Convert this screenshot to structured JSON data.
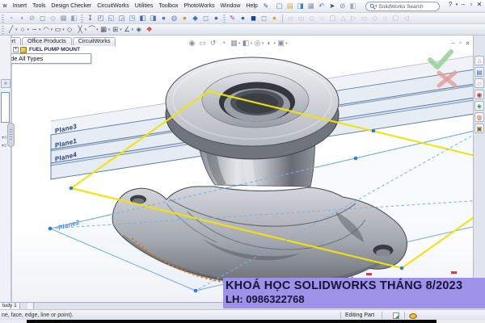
{
  "titlebar": {
    "menu_items": [
      "w",
      "Insert",
      "Tools",
      "Design Checker",
      "CircuitWorks",
      "Utilities",
      "Toolbox",
      "PhotoWorks",
      "Window",
      "Help"
    ],
    "search_placeholder": "SolidWorks Search",
    "window": {
      "help": "?",
      "help_caret": "▾",
      "minimize": "–",
      "restore": "▫",
      "close": "✕"
    },
    "standard_icons": [
      {
        "n": "new-document-icon",
        "g": "▢",
        "c": "#4d79b8"
      },
      {
        "n": "open-icon",
        "g": "▤",
        "c": "#d9a33c"
      },
      {
        "n": "save-icon",
        "g": "◨",
        "c": "#5577aa"
      },
      {
        "n": "print-icon",
        "g": "▦",
        "c": "#8894a6"
      },
      {
        "n": "undo-icon",
        "g": "↶",
        "c": "#3a7abd"
      },
      {
        "n": "select-arrow-icon",
        "g": "➤",
        "c": "#3c414b"
      },
      {
        "n": "attach-icon",
        "g": "⊘",
        "c": "#7d8798"
      },
      {
        "n": "options-icon",
        "g": "◧",
        "c": "#9aa5b6"
      }
    ],
    "pen_icon": {
      "n": "pen-icon",
      "g": "✎",
      "c": "#555c68"
    }
  },
  "toolbars": {
    "view_group": [
      {
        "n": "zoom-fit-icon",
        "g": "◔",
        "c": "#8e99ab"
      },
      {
        "n": "rotate-view-icon",
        "g": "◑",
        "c": "#8e99ab"
      },
      {
        "n": "pan-icon",
        "g": "⊘",
        "c": "#8e99ab"
      },
      {
        "n": "shaded-icon",
        "g": "◻",
        "c": "#4a9e4a"
      },
      {
        "n": "wireframe-icon",
        "g": "◇",
        "c": "#8e99ab"
      },
      {
        "n": "section-icon",
        "g": "▦",
        "c": "#8e99ab"
      },
      {
        "n": "perspective-icon",
        "g": "◧",
        "c": "#8e99ab"
      }
    ],
    "feature_group": [
      {
        "n": "insert-component-icon",
        "g": "↧",
        "c": "#3f62b5"
      },
      {
        "n": "extrude-icon",
        "g": "◰",
        "c": "#476fae"
      },
      {
        "n": "revolve-icon",
        "g": "◱",
        "c": "#5a82c0"
      },
      {
        "n": "sweep-icon",
        "g": "◲",
        "c": "#476fae"
      },
      {
        "n": "loft-icon",
        "g": "◳",
        "c": "#5a82c0"
      },
      {
        "n": "boss-icon",
        "g": "◧",
        "c": "#3f62b5"
      },
      {
        "n": "cut-icon",
        "g": "◨",
        "c": "#476fae"
      },
      {
        "n": "fillet-icon",
        "g": "●",
        "c": "#4a74b8"
      },
      {
        "n": "chamfer-icon",
        "g": "◍",
        "c": "#5a82c0"
      },
      {
        "n": "shell-icon",
        "g": "●",
        "c": "#d78c2a"
      },
      {
        "n": "rib-icon",
        "g": "◆",
        "c": "#476fae"
      },
      {
        "n": "draft-icon",
        "g": "◻",
        "c": "#5a82c0"
      },
      {
        "n": "dome-icon",
        "g": "●",
        "c": "#3f62b5"
      }
    ],
    "tool_group": [
      {
        "n": "sketch-pen-icon",
        "g": "✎",
        "c": "#8a4a9e"
      },
      {
        "n": "sphere-blue-icon",
        "g": "●",
        "c": "#2f64b0"
      },
      {
        "n": "cube-dark-icon",
        "g": "◼",
        "c": "#1f3f8f"
      },
      {
        "n": "cube-light-icon",
        "g": "◻",
        "c": "#7a8699"
      },
      {
        "n": "render-ball-icon",
        "g": "●",
        "c": "#e3a51a"
      }
    ],
    "disabled_group": [
      {
        "n": "assembly-icon-1",
        "g": "▱",
        "c": "#b4bccb"
      },
      {
        "n": "assembly-icon-2",
        "g": "▭",
        "c": "#b4bccb"
      },
      {
        "n": "assembly-icon-3",
        "g": "◇",
        "c": "#b4bccb"
      },
      {
        "n": "assembly-icon-4",
        "g": "○",
        "c": "#b4bccb"
      },
      {
        "n": "assembly-icon-5",
        "g": "▢",
        "c": "#b4bccb"
      },
      {
        "n": "assembly-icon-6",
        "g": "△",
        "c": "#b4bccb"
      },
      {
        "n": "assembly-icon-7",
        "g": "▷",
        "c": "#b4bccb"
      },
      {
        "n": "assembly-icon-8",
        "g": "▭",
        "c": "#b4bccb"
      },
      {
        "n": "assembly-icon-9",
        "g": "◇",
        "c": "#b4bccb"
      },
      {
        "n": "assembly-icon-10",
        "g": "○",
        "c": "#b4bccb"
      },
      {
        "n": "assembly-icon-11",
        "g": "▢",
        "c": "#b4bccb"
      },
      {
        "n": "assembly-icon-12",
        "g": "◁",
        "c": "#b4bccb"
      }
    ],
    "sketch_group": [
      {
        "n": "line-tool-icon",
        "g": "╱",
        "c": "#4d5666",
        "v": 1
      },
      {
        "n": "circle-tool-icon",
        "g": "○",
        "c": "#4d5666",
        "v": 1
      },
      {
        "n": "spline-tool-icon",
        "g": "∼",
        "c": "#4d5666",
        "v": 1
      },
      {
        "n": "arc-tool-icon",
        "g": "◠",
        "c": "#4d5666",
        "v": 1
      },
      {
        "n": "rectangle-tool-icon",
        "g": "▭",
        "c": "#4d5666",
        "v": 1
      },
      {
        "n": "polygon-tool-icon",
        "g": "◇",
        "c": "#4d5666"
      },
      {
        "n": "trim-tool-icon",
        "g": "╳",
        "c": "#4d5666",
        "v": 1
      },
      {
        "n": "offset-tool-icon",
        "g": "⌒",
        "c": "#4d5666",
        "v": 1
      },
      {
        "n": "pattern-tool-icon",
        "g": "▦",
        "c": "#4d5666",
        "v": 1
      },
      {
        "n": "mirror-tool-icon",
        "g": "⊞",
        "c": "#4d5666",
        "v": 1
      },
      {
        "n": "dimension-tool-icon",
        "g": "∠",
        "c": "#4d5666",
        "v": 1
      },
      {
        "n": "relations-tool-icon",
        "g": "◈",
        "c": "#4d5666"
      },
      {
        "n": "xpert-icon",
        "g": "❖",
        "c": "#cc3322"
      }
    ]
  },
  "command_tabs": [
    "pert",
    "Office Products",
    "CircuitWorks"
  ],
  "feature_tree": {
    "root_label": "FUEL PUMP MOUNT",
    "expander": "+",
    "dropdown_item": "Hide All Types"
  },
  "headsup_icons": [
    {
      "n": "zoom-to-fit-icon",
      "g": "◉",
      "c": "#5d6a80"
    },
    {
      "n": "zoom-area-icon",
      "g": "▭",
      "c": "#5d6a80"
    },
    {
      "n": "previous-view-icon",
      "g": "↺",
      "c": "#5d6a80"
    },
    {
      "n": "section-view-icon",
      "g": "◔",
      "c": "#5d6a80"
    },
    {
      "n": "view-orientation-icon",
      "g": "▦",
      "c": "#5d6a80",
      "v": 1
    },
    {
      "n": "display-style-icon",
      "g": "◧",
      "c": "#5d6a80",
      "v": 1
    },
    {
      "n": "hide-show-icon",
      "g": "◎",
      "c": "#5d6a80",
      "v": 1
    },
    {
      "n": "appearance-icon",
      "g": "◐",
      "c": "#5d6a80",
      "v": 1
    },
    {
      "n": "scene-icon",
      "g": "▣",
      "c": "#5d6a80",
      "v": 1
    }
  ],
  "taskpane_icons": [
    {
      "n": "resources-home-icon",
      "g": "⌂",
      "c": "#c7742a"
    },
    {
      "n": "design-library-icon",
      "g": "▤",
      "c": "#3f62b5"
    },
    {
      "n": "file-explorer-icon",
      "g": "▱",
      "c": "#d9a33c"
    },
    {
      "n": "toolbox-icon",
      "g": "◉",
      "c": "#c03a3a"
    },
    {
      "n": "drawings-icon",
      "g": "◈",
      "c": "#3a8f4a"
    },
    {
      "n": "appearances-icon",
      "g": "◍",
      "c": "#d06a2a"
    },
    {
      "n": "custom-props-icon",
      "g": "▣",
      "c": "#8a6a3a"
    }
  ],
  "doc_controls": {
    "minimize": "‒",
    "restore": "▫",
    "close": "✕"
  },
  "viewport": {
    "plane_labels": {
      "p3": "Plane3",
      "p1": "Plane1",
      "p4": "Plane4",
      "p2": "Plane2"
    },
    "colors": {
      "plane_edge": "#54749f",
      "selected_plane_yellow": "#f2e30a",
      "reference_plane_blue": "#7ab2e6",
      "highlight_edge_orange": "#e0761a",
      "confirm_check_green": "#8fce8f",
      "cancel_x_red": "#e89a9a"
    }
  },
  "banner": {
    "line1": "KHOÁ HỌC SOLIDWORKS THÁNG 8/2023",
    "line2": "LH: 0986322768",
    "bg_color": "#9c93e8"
  },
  "bottom_tabs": {
    "partial_tab": "tudy 1"
  },
  "status_bar": {
    "message": "ne, face, edge, line or point).",
    "mode": "Editing Part"
  }
}
